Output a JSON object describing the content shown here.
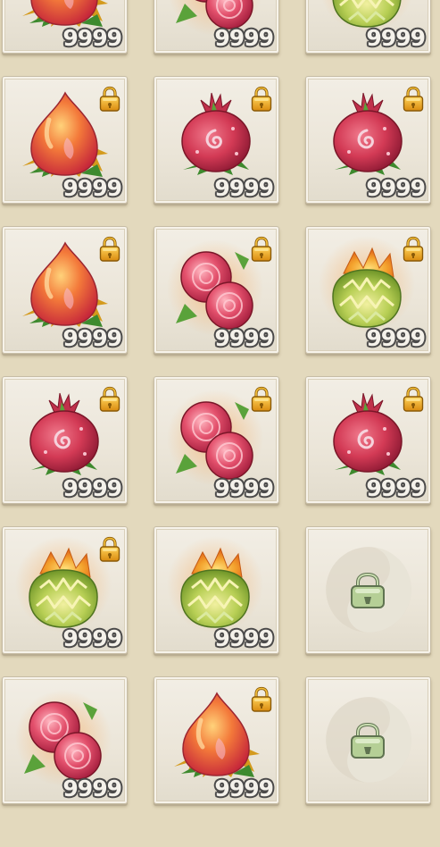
{
  "inventory": {
    "rows": [
      {
        "slots": [
          {
            "item": "peach-fruit",
            "count": "9999",
            "locked": false
          },
          {
            "item": "red-berries",
            "count": "9999",
            "locked": false
          },
          {
            "item": "golden-lotus",
            "count": "9999",
            "locked": false
          }
        ]
      },
      {
        "slots": [
          {
            "item": "peach-fruit",
            "count": "9999",
            "locked": true
          },
          {
            "item": "pomegranate",
            "count": "9999",
            "locked": true
          },
          {
            "item": "pomegranate",
            "count": "9999",
            "locked": true
          }
        ]
      },
      {
        "slots": [
          {
            "item": "peach-fruit",
            "count": "9999",
            "locked": true
          },
          {
            "item": "red-berries",
            "count": "9999",
            "locked": true
          },
          {
            "item": "golden-lotus",
            "count": "9999",
            "locked": true
          }
        ]
      },
      {
        "slots": [
          {
            "item": "pomegranate",
            "count": "9999",
            "locked": true
          },
          {
            "item": "red-berries",
            "count": "9999",
            "locked": true
          },
          {
            "item": "pomegranate",
            "count": "9999",
            "locked": true
          }
        ]
      },
      {
        "slots": [
          {
            "item": "golden-lotus",
            "count": "9999",
            "locked": true
          },
          {
            "item": "golden-lotus",
            "count": "9999",
            "locked": false
          },
          {
            "item": "empty-locked-slot",
            "count": "",
            "locked": false
          }
        ]
      },
      {
        "slots": [
          {
            "item": "red-berries",
            "count": "9999",
            "locked": false
          },
          {
            "item": "peach-fruit",
            "count": "9999",
            "locked": true
          },
          {
            "item": "empty-locked-slot",
            "count": "",
            "locked": false
          }
        ]
      }
    ]
  },
  "colors": {
    "background": "#e3d9bd",
    "slot": "#ece6d9",
    "count_text": "#f4f1ea",
    "count_outline": "#4b4a4a",
    "lock_gold": "#e8a21a"
  }
}
